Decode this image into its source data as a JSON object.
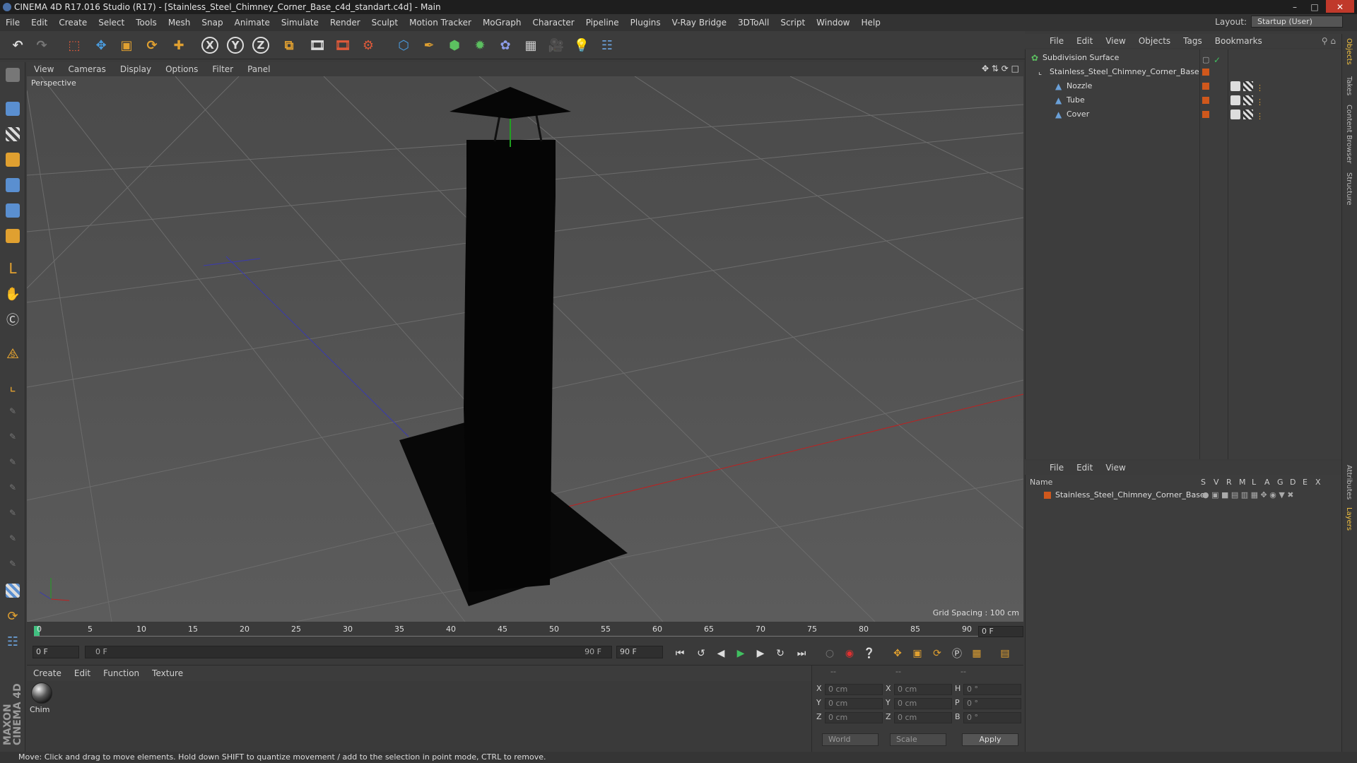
{
  "window": {
    "title": "CINEMA 4D R17.016 Studio (R17) - [Stainless_Steel_Chimney_Corner_Base_c4d_standart.c4d] - Main"
  },
  "menubar": {
    "items": [
      "File",
      "Edit",
      "Create",
      "Select",
      "Tools",
      "Mesh",
      "Snap",
      "Animate",
      "Simulate",
      "Render",
      "Sculpt",
      "Motion Tracker",
      "MoGraph",
      "Character",
      "Pipeline",
      "Plugins",
      "V-Ray Bridge",
      "3DToAll",
      "Script",
      "Window",
      "Help"
    ],
    "layout_label": "Layout:",
    "layout_value": "Startup (User)"
  },
  "toolbar": {
    "axis_x": "X",
    "axis_y": "Y",
    "axis_z": "Z"
  },
  "viewport": {
    "menu": [
      "View",
      "Cameras",
      "Display",
      "Options",
      "Filter",
      "Panel"
    ],
    "camera_label": "Perspective",
    "grid_spacing": "Grid Spacing : 100 cm"
  },
  "timeline": {
    "ticks": [
      "0",
      "5",
      "10",
      "15",
      "20",
      "25",
      "30",
      "35",
      "40",
      "45",
      "50",
      "55",
      "60",
      "65",
      "70",
      "75",
      "80",
      "85",
      "90"
    ],
    "current_frame": "0 F"
  },
  "transport": {
    "start_frame": "0 F",
    "range_start": "0 F",
    "range_end": "90 F",
    "end_frame": "90 F"
  },
  "material_manager": {
    "menu": [
      "Create",
      "Edit",
      "Function",
      "Texture"
    ],
    "materials": [
      {
        "name": "Chim"
      }
    ]
  },
  "coordinates": {
    "header": [
      "--",
      "--",
      "--"
    ],
    "rows": [
      {
        "axis": "X",
        "pos": "0 cm",
        "axis2": "X",
        "size": "0 cm",
        "rot_label": "H",
        "rot": "0 °"
      },
      {
        "axis": "Y",
        "pos": "0 cm",
        "axis2": "Y",
        "size": "0 cm",
        "rot_label": "P",
        "rot": "0 °"
      },
      {
        "axis": "Z",
        "pos": "0 cm",
        "axis2": "Z",
        "size": "0 cm",
        "rot_label": "B",
        "rot": "0 °"
      }
    ],
    "mode": "World",
    "scale_mode": "Scale",
    "apply_label": "Apply"
  },
  "object_manager": {
    "menu": [
      "File",
      "Edit",
      "View",
      "Objects",
      "Tags",
      "Bookmarks"
    ],
    "objects": [
      {
        "name": "Subdivision Surface"
      },
      {
        "name": "Stainless_Steel_Chimney_Corner_Base"
      },
      {
        "name": "Nozzle"
      },
      {
        "name": "Tube"
      },
      {
        "name": "Cover"
      }
    ]
  },
  "layer_manager": {
    "menu": [
      "File",
      "Edit",
      "View"
    ],
    "columns": [
      "Name",
      "S",
      "V",
      "R",
      "M",
      "L",
      "A",
      "G",
      "D",
      "E",
      "X"
    ],
    "layers": [
      {
        "name": "Stainless_Steel_Chimney_Corner_Base"
      }
    ]
  },
  "right_tabs": [
    "Objects",
    "Takes",
    "Content Browser",
    "Structure",
    "Attributes",
    "Layers"
  ],
  "branding": "MAXON CINEMA 4D",
  "status": {
    "message": "Move: Click and drag to move elements. Hold down SHIFT to quantize movement / add to the selection in point mode, CTRL to remove."
  },
  "colors": {
    "layer_color": "#d0581c",
    "accent_active": "#f0c040"
  }
}
